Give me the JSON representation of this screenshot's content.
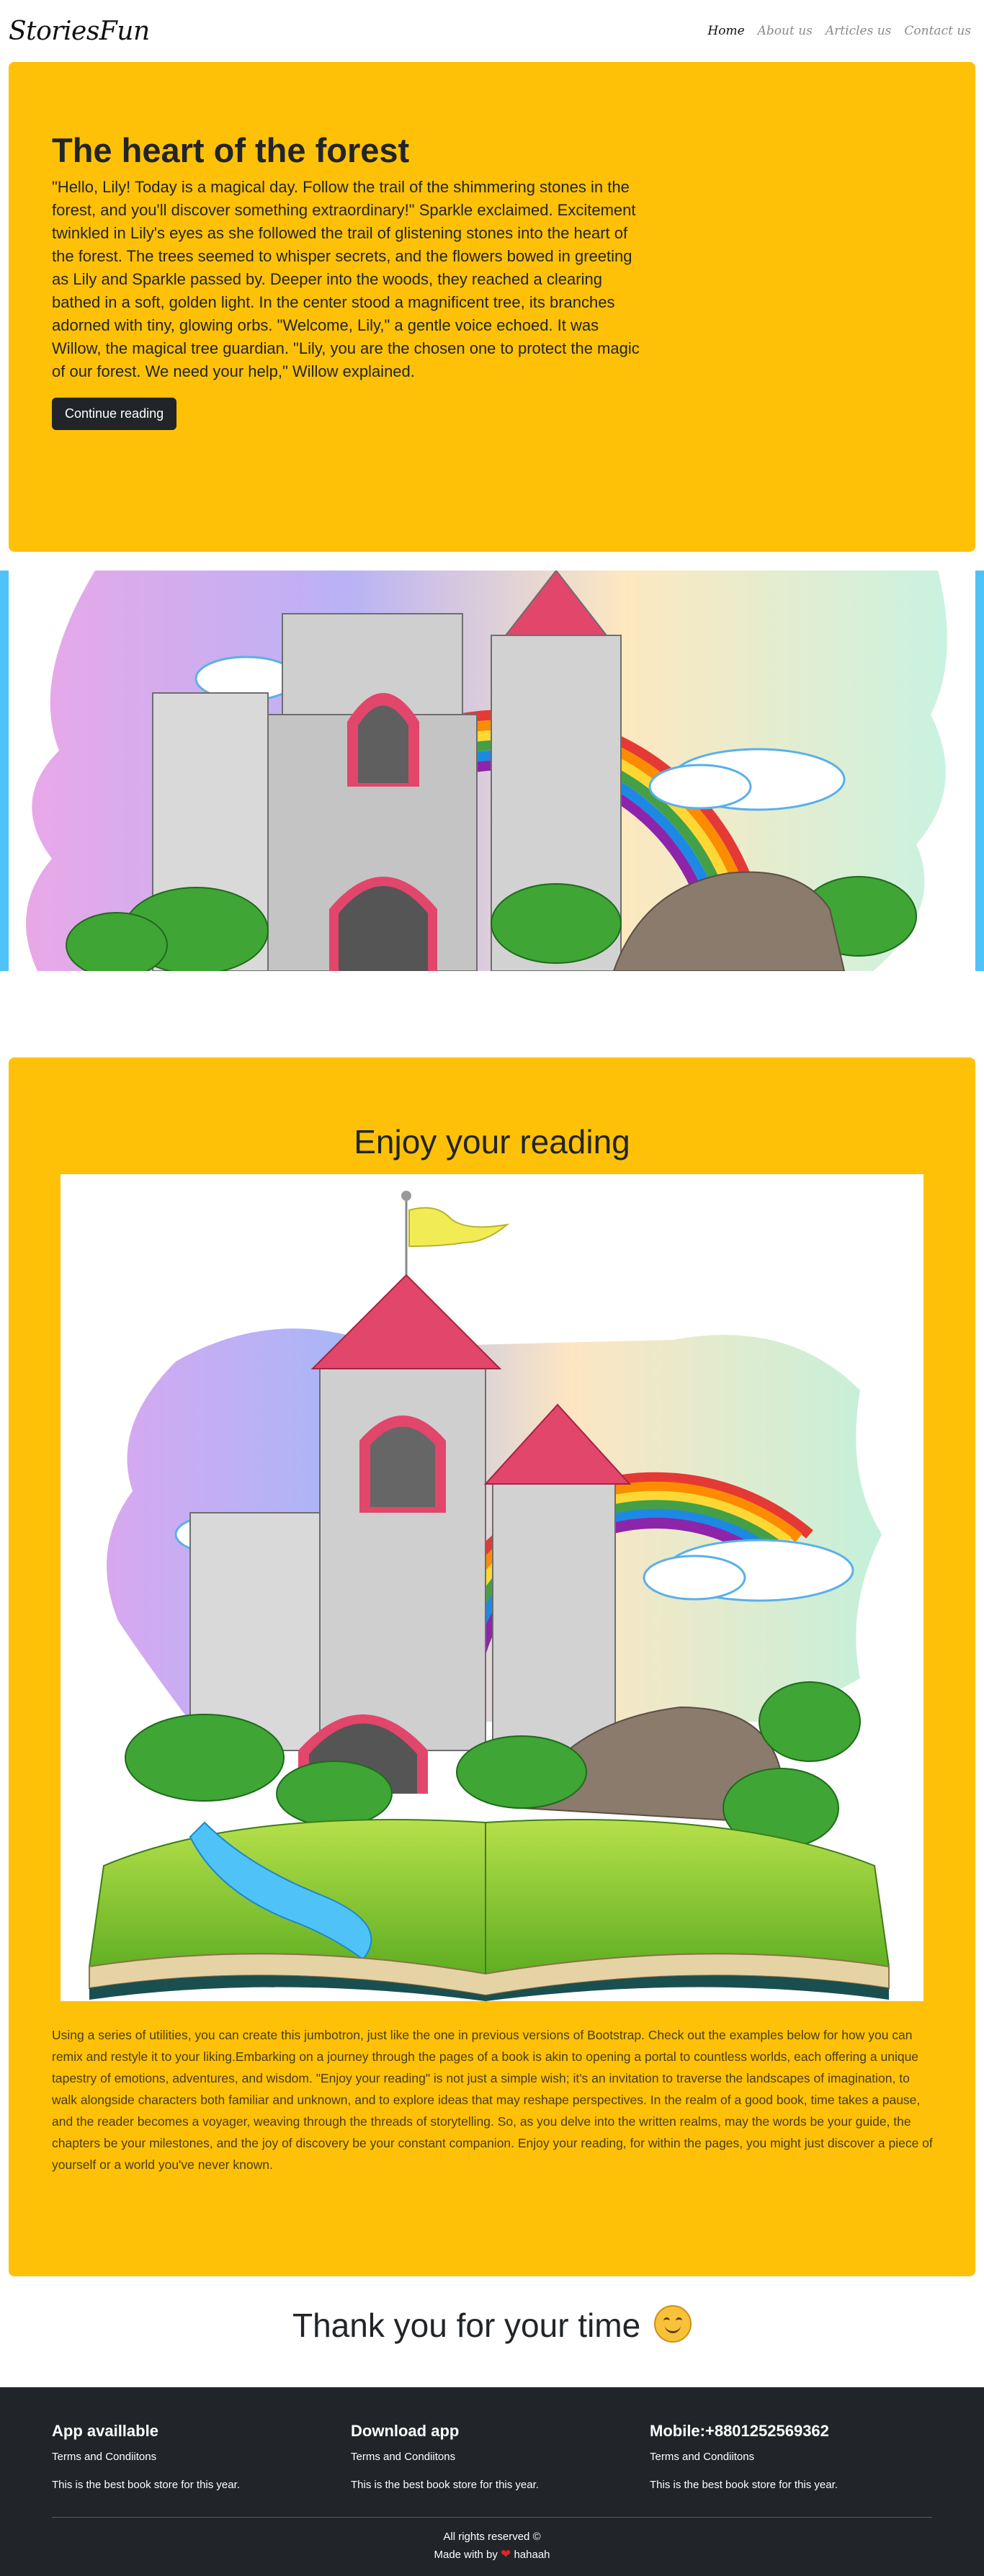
{
  "navbar": {
    "brand": "StoriesFun",
    "links": [
      "Home",
      "About us",
      "Articles us",
      "Contact us"
    ],
    "active_index": 0
  },
  "hero": {
    "title": "The heart of the forest",
    "text": "\"Hello, Lily! Today is a magical day. Follow the trail of the shimmering stones in the forest, and you'll discover something extraordinary!\" Sparkle exclaimed. Excitement twinkled in Lily's eyes as she followed the trail of glistening stones into the heart of the forest. The trees seemed to whisper secrets, and the flowers bowed in greeting as Lily and Sparkle passed by. Deeper into the woods, they reached a clearing bathed in a soft, golden light. In the center stood a magnificent tree, its branches adorned with tiny, glowing orbs. \"Welcome, Lily,\" a gentle voice echoed. It was Willow, the magical tree guardian. \"Lily, you are the chosen one to protect the magic of our forest. We need your help,\" Willow explained.",
    "button": "Continue reading"
  },
  "reading": {
    "title": "Enjoy your reading",
    "text": "Using a series of utilities, you can create this jumbotron, just like the one in previous versions of Bootstrap. Check out the examples below for how you can remix and restyle it to your liking.Embarking on a journey through the pages of a book is akin to opening a portal to countless worlds, each offering a unique tapestry of emotions, adventures, and wisdom. \"Enjoy your reading\" is not just a simple wish; it's an invitation to traverse the landscapes of imagination, to walk alongside characters both familiar and unknown, and to explore ideas that may reshape perspectives. In the realm of a good book, time takes a pause, and the reader becomes a voyager, weaving through the threads of storytelling. So, as you delve into the written realms, may the words be your guide, the chapters be your milestones, and the joy of discovery be your constant companion. Enjoy your reading, for within the pages, you might just discover a piece of yourself or a world you've never known."
  },
  "thanks": {
    "text": "Thank you for your time"
  },
  "footer": {
    "columns": [
      {
        "title": "App availlable",
        "link": "Terms and Condiitons",
        "text": "This is the best book store for this year."
      },
      {
        "title": "Download app",
        "link": "Terms and Condiitons",
        "text": "This is the best book store for this year."
      },
      {
        "title": "Mobile:+8801252569362",
        "link": "Terms and Condiitons",
        "text": "This is the best book store for this year."
      }
    ],
    "rights": "All rights reserved ©",
    "made_with": "Made with by",
    "author": "hahaah"
  },
  "colors": {
    "accent": "#ffc107",
    "dark": "#212529",
    "carousel_edge": "#4fc3f7"
  },
  "icons": [
    "smile-emoji-icon",
    "heart-icon"
  ]
}
